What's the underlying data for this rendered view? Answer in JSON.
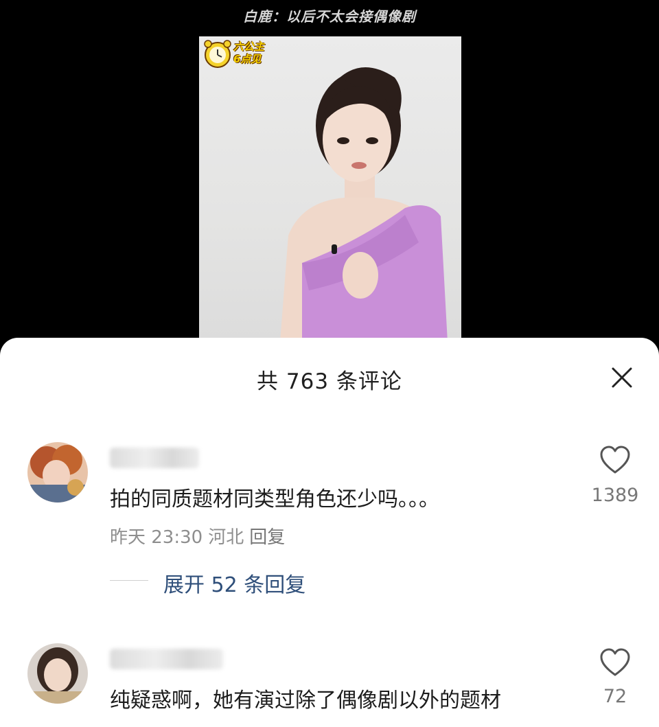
{
  "video": {
    "title": "白鹿：以后不太会接偶像剧",
    "badge": {
      "line1": "六公主",
      "line2": "6点见",
      "icon": "alarm-clock-icon"
    }
  },
  "comments_sheet": {
    "title": "共 763 条评论",
    "close_icon": "close-icon",
    "comments": [
      {
        "text": "拍的同质题材同类型角色还少吗。。。",
        "time": "昨天 23:30",
        "location": "河北",
        "reply_label": "回复",
        "likes": "1389",
        "expand_label": "展开 52 条回复"
      },
      {
        "text": "纯疑惑啊，她有演过除了偶像剧以外的题材",
        "likes": "72"
      }
    ]
  },
  "colors": {
    "accent_link": "#2f4f7a",
    "dress": "#c98fd8"
  }
}
